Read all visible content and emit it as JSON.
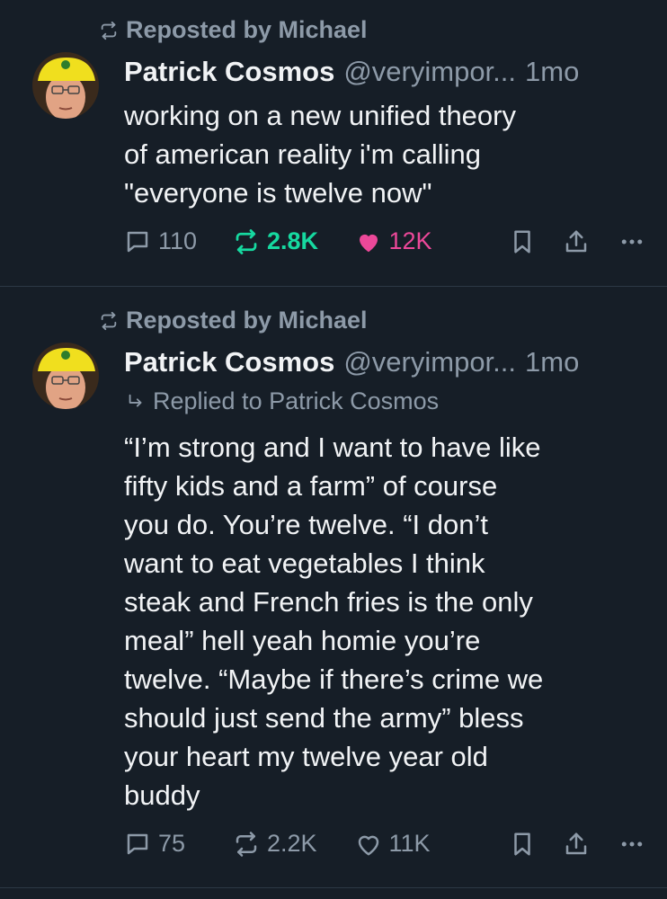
{
  "posts": [
    {
      "repost_label": "Reposted by Michael",
      "author": "Patrick Cosmos",
      "handle": "@veryimpor...",
      "time": "1mo",
      "reply_to": "",
      "text": "working on a new unified theory\nof american reality i'm calling\n\"everyone is twelve now\"",
      "replies": "110",
      "reposts": "2.8K",
      "likes": "12K",
      "reposted": true,
      "liked": true
    },
    {
      "repost_label": "Reposted by Michael",
      "author": "Patrick Cosmos",
      "handle": "@veryimpor...",
      "time": "1mo",
      "reply_to": "Replied to Patrick Cosmos",
      "text": "“I’m strong and I want to have like\nfifty kids and a farm” of course\nyou do. You’re twelve. “I don’t\nwant to eat vegetables I think\nsteak and French fries is the only\nmeal” hell yeah homie you’re\ntwelve. “Maybe if there’s crime we\nshould just send the army” bless\nyour heart my twelve year old\nbuddy",
      "replies": "75",
      "reposts": "2.2K",
      "likes": "11K",
      "reposted": false,
      "liked": false
    }
  ],
  "icons": {
    "repost": "repost-icon",
    "reply": "speech-bubble-icon",
    "like": "heart-icon",
    "bookmark": "bookmark-icon",
    "share": "share-icon",
    "more": "ellipsis-icon",
    "reply_arrow": "reply-arrow-icon"
  },
  "colors": {
    "background": "#161e27",
    "muted": "#8d9aa8",
    "repost_active": "#16d9a0",
    "like_active": "#ec4899"
  }
}
